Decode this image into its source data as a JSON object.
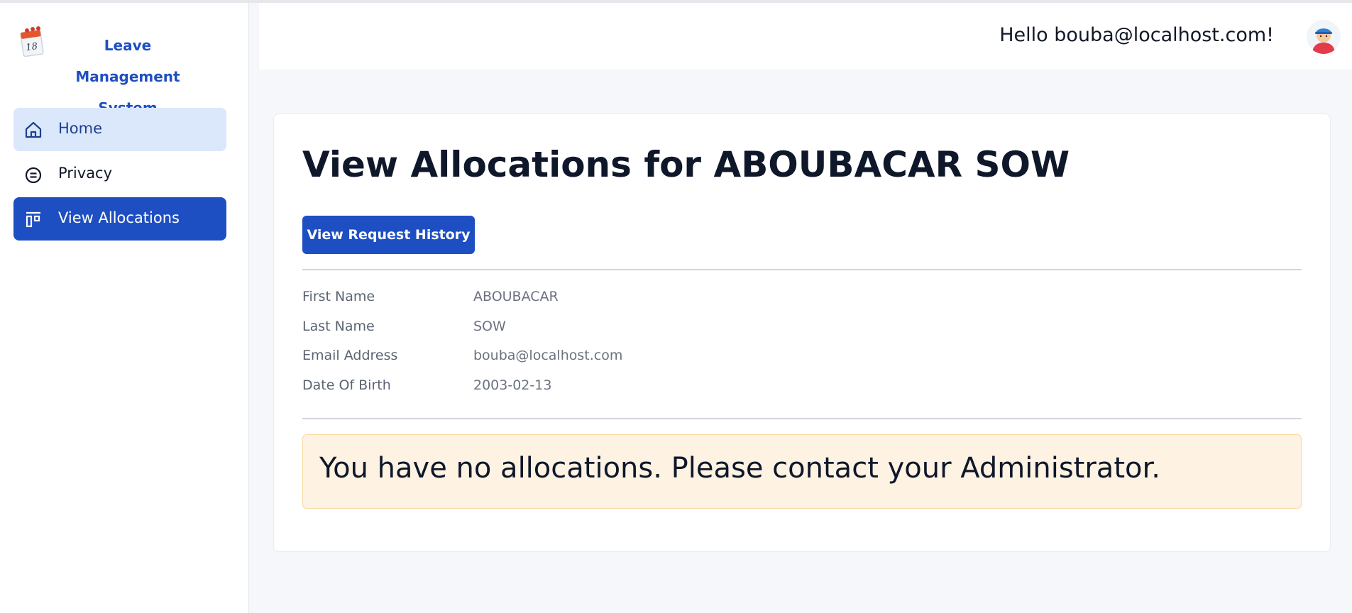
{
  "brand": {
    "name_line1": "Leave  Management",
    "name_line2": "System",
    "icon": "calendar-icon",
    "icon_day": "18",
    "color": "#1e4fc2"
  },
  "sidebar": {
    "items": [
      {
        "label": "Home",
        "icon": "home-icon",
        "state": "hover"
      },
      {
        "label": "Privacy",
        "icon": "privacy-icon",
        "state": "normal"
      },
      {
        "label": "View Allocations",
        "icon": "allocations-icon",
        "state": "active"
      }
    ]
  },
  "header": {
    "greeting": "Hello bouba@localhost.com!",
    "avatar_icon": "user-avatar-icon"
  },
  "main": {
    "title": "View Allocations for ABOUBACAR SOW",
    "history_button_label": "View Request History",
    "details": [
      {
        "label": "First Name",
        "value": "ABOUBACAR"
      },
      {
        "label": "Last Name",
        "value": "SOW"
      },
      {
        "label": "Email Address",
        "value": "bouba@localhost.com"
      },
      {
        "label": "Date Of Birth",
        "value": "2003-02-13"
      }
    ],
    "alert_message": "You have no allocations. Please contact your Administrator."
  },
  "colors": {
    "primary": "#1e4fc2",
    "home_hover_bg": "#dbe8fc",
    "alert_bg": "#fef2e2",
    "alert_border": "#fbd89f",
    "page_bg": "#f5f7fb"
  }
}
